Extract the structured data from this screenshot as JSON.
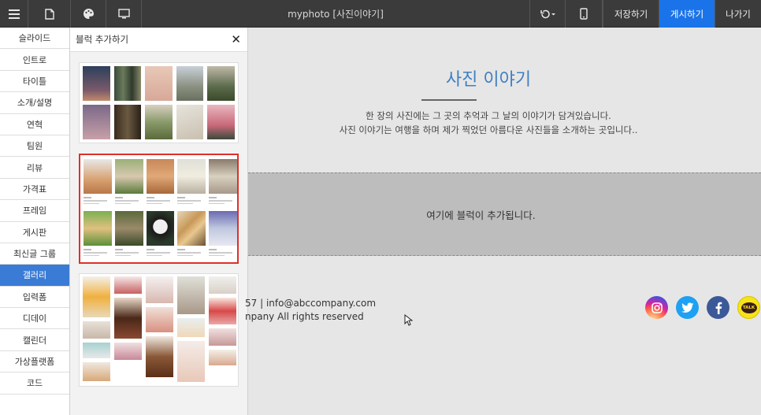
{
  "topbar": {
    "menu_icon": "hamburger-menu-icon",
    "page_icon": "document-icon",
    "design_icon": "palette-icon",
    "preview_icon": "monitor-icon",
    "title": "myphoto [사진이야기]",
    "undo_icon": "undo-icon",
    "mobile_icon": "mobile-phone-icon",
    "save_label": "저장하기",
    "publish_label": "게시하기",
    "exit_label": "나가기",
    "publish_color": "#1a73e8"
  },
  "leftnav": {
    "items": [
      "슬라이드",
      "인트로",
      "타이틀",
      "소개/설명",
      "연혁",
      "팀원",
      "리뷰",
      "가격표",
      "프레임",
      "게시판",
      "최신글 그룹",
      "갤러리",
      "입력폼",
      "디데이",
      "캘린더",
      "가상플랫폼",
      "코드"
    ],
    "active_index": 11,
    "active_color": "#3a7bd5"
  },
  "panel": {
    "title": "블럭 추가하기",
    "close_icon": "close-x-icon",
    "selected_border_color": "#e0302a"
  },
  "canvas": {
    "hero_title": "사진 이야기",
    "hero_desc_1": "한 장의 사진에는 그 곳의 추억과 그 날의 이야기가 담겨있습니다.",
    "hero_desc_2": "사진 이야기는 여행을 하며 제가 찍었던 아름다운 사진들을 소개하는 곳입니다..",
    "dropzone_text": "여기에 블럭이 추가됩니다.",
    "footer_line_1": "57 | info@abccompany.com",
    "footer_line_2": "npany All rights reserved",
    "title_color": "#3f7fc1",
    "social_icons": [
      "instagram-icon",
      "twitter-icon",
      "facebook-icon",
      "kakaotalk-icon"
    ],
    "kakao_label": "TALK"
  }
}
